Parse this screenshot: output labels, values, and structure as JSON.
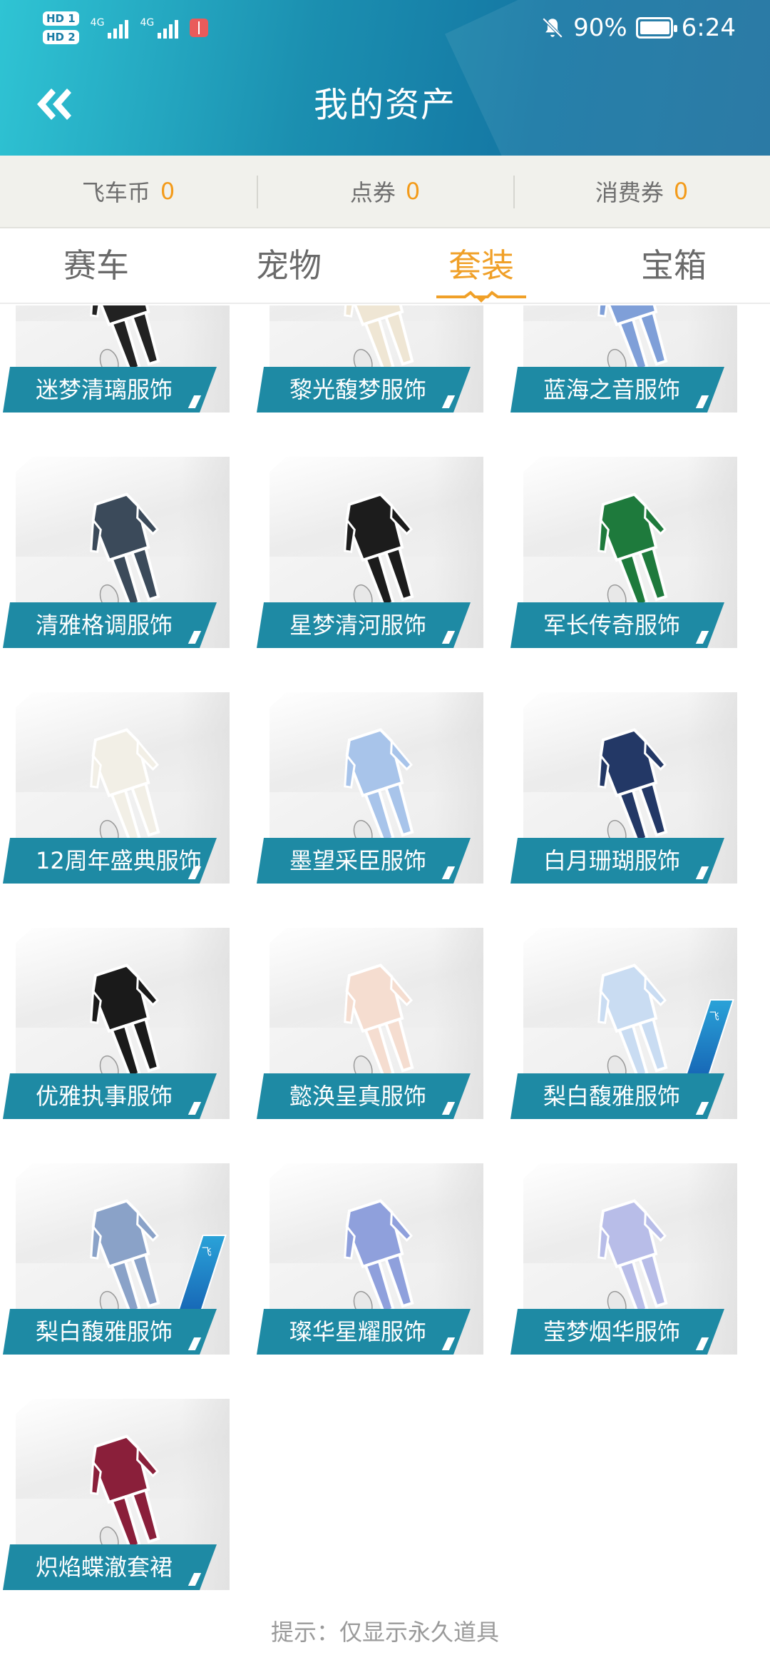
{
  "status_bar": {
    "sim1": "HD 1",
    "sim2": "HD 2",
    "net1": "4G",
    "net2": "4G",
    "battery": "90%",
    "time": "6:24",
    "icons": [
      "bell-off-icon",
      "battery-icon",
      "book-icon"
    ]
  },
  "header": {
    "title": "我的资产",
    "back_icon": "double-chevron-left-icon"
  },
  "currency": [
    {
      "label": "飞车币",
      "value": "0"
    },
    {
      "label": "点券",
      "value": "0"
    },
    {
      "label": "消费券",
      "value": "0"
    }
  ],
  "tabs": [
    {
      "label": "赛车",
      "active": false
    },
    {
      "label": "宠物",
      "active": false
    },
    {
      "label": "套装",
      "active": true
    },
    {
      "label": "宝箱",
      "active": false
    }
  ],
  "items": [
    {
      "name": "迷梦清璃服饰",
      "color": "#222222",
      "badge": ""
    },
    {
      "name": "黎光馥梦服饰",
      "color": "#efe6d4",
      "badge": ""
    },
    {
      "name": "蓝海之音服饰",
      "color": "#7f9fd8",
      "badge": ""
    },
    {
      "name": "清雅格调服饰",
      "color": "#3b4a5a",
      "badge": ""
    },
    {
      "name": "星梦清河服饰",
      "color": "#1c1c1c",
      "badge": ""
    },
    {
      "name": "军长传奇服饰",
      "color": "#1e7a3c",
      "badge": ""
    },
    {
      "name": "12周年盛典服饰",
      "color": "#f2efe6",
      "badge": ""
    },
    {
      "name": "墨望采臣服饰",
      "color": "#a8c4ea",
      "badge": ""
    },
    {
      "name": "白月珊瑚服饰",
      "color": "#233866",
      "badge": ""
    },
    {
      "name": "优雅执事服饰",
      "color": "#1a1a1a",
      "badge": ""
    },
    {
      "name": "懿涣呈真服饰",
      "color": "#f5ddd0",
      "badge": ""
    },
    {
      "name": "梨白馥雅服饰",
      "color": "#c9dcf2",
      "badge": "飞"
    },
    {
      "name": "梨白馥雅服饰",
      "color": "#8aa2c8",
      "badge": "飞"
    },
    {
      "name": "璨华星耀服饰",
      "color": "#8fa0dc",
      "badge": ""
    },
    {
      "name": "莹梦烟华服饰",
      "color": "#b8bde8",
      "badge": ""
    },
    {
      "name": "炽焰蝶澈套裙",
      "color": "#8a1f3a",
      "badge": ""
    }
  ],
  "hint": "提示：仅显示永久道具",
  "colors": {
    "accent": "#f0a028",
    "label_bg": "#1e8aa4",
    "header_from": "#2fc4d4",
    "header_to": "#1476a3"
  }
}
